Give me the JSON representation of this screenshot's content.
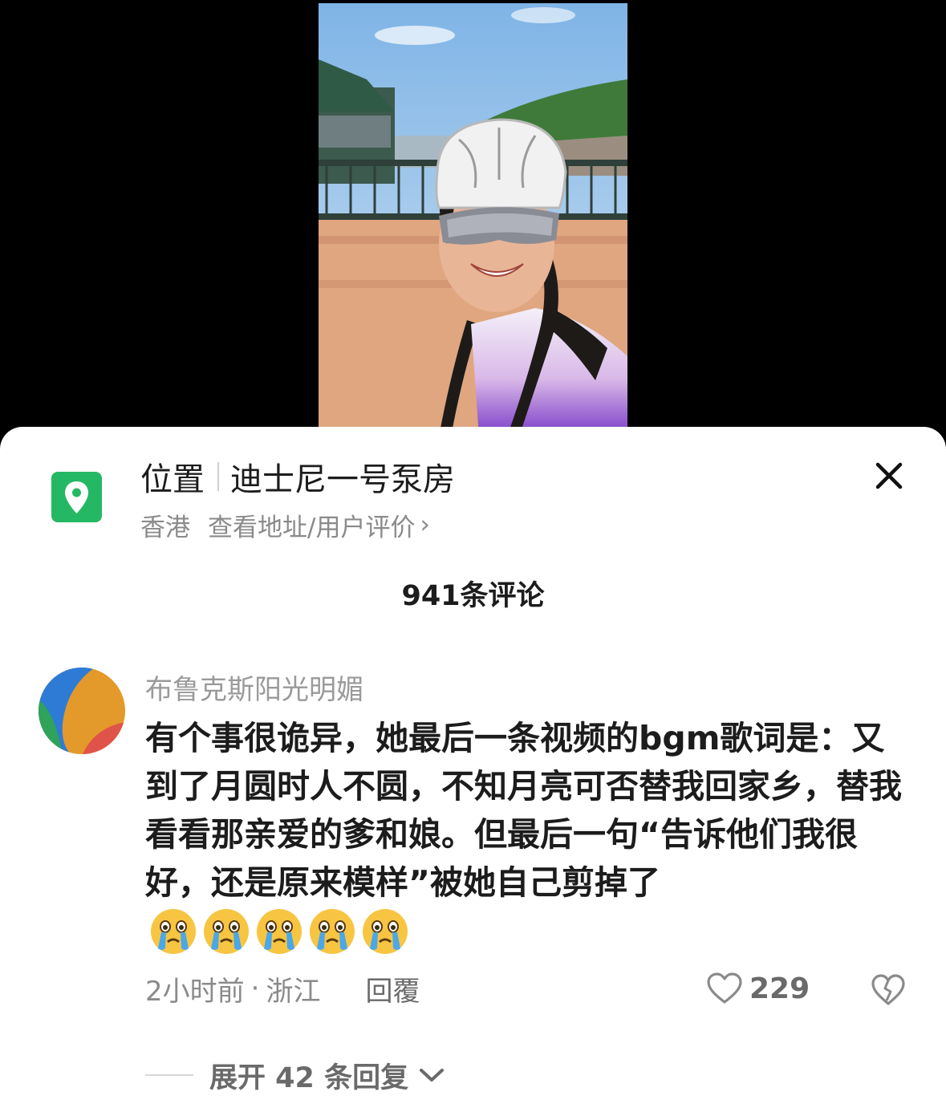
{
  "location": {
    "label": "位置",
    "name": "迪士尼一号泵房",
    "region": "香港",
    "link": "查看地址/用户评价",
    "link_chevron": "›"
  },
  "comments_header": "941条评论",
  "comment": {
    "username": "布鲁克斯阳光明媚",
    "text": "有个事很诡异，她最后一条视频的bgm歌词是：又到了月圆时人不圆，不知月亮可否替我回家乡，替我看看那亲爱的爹和娘。但最后一句“告诉他们我很好，还是原来模样”被她自己剪掉了",
    "emoji_icons": [
      "crying-emoji",
      "crying-emoji",
      "crying-emoji",
      "crying-emoji",
      "crying-emoji"
    ],
    "time": "2小时前",
    "dot": "·",
    "place": "浙江",
    "reply_label": "回覆",
    "likes": "229"
  },
  "expand_replies": "展开 42 条回复",
  "colors": {
    "location_green": "#25b864",
    "primary_text": "#1c1c1c",
    "secondary_text": "#8a8a8a"
  }
}
